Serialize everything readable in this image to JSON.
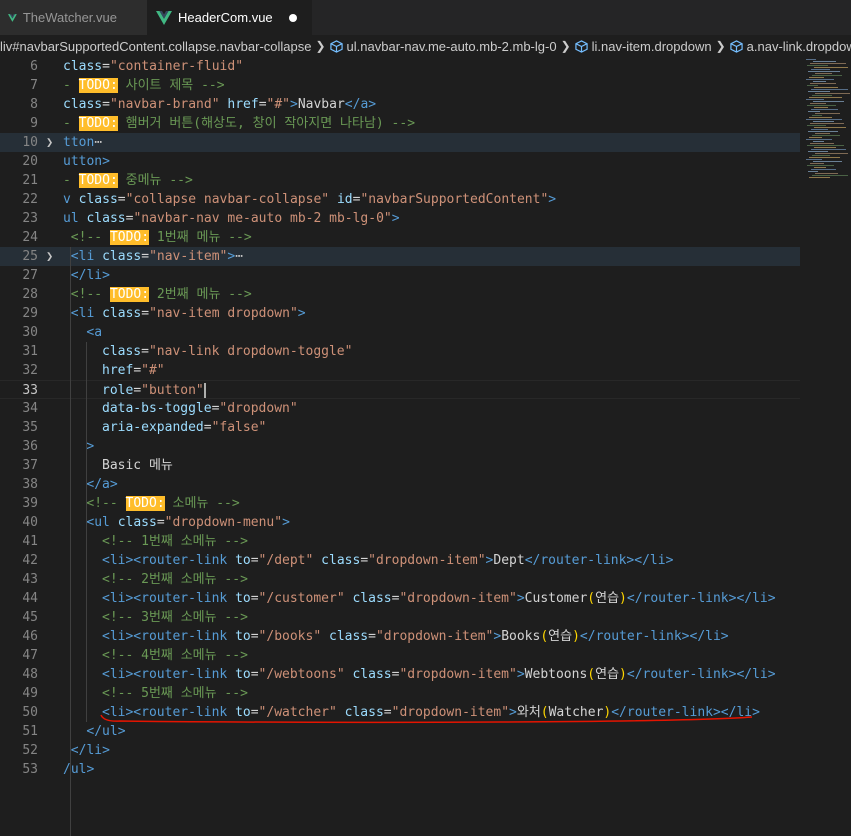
{
  "tabs": [
    {
      "label": "TheWatcher.vue",
      "active": false,
      "icon": "vue-icon"
    },
    {
      "label": "HeaderCom.vue",
      "active": true,
      "icon": "vue-icon",
      "dirty": true
    }
  ],
  "breadcrumb": [
    {
      "label": "liv#navbarSupportedContent.collapse.navbar-collapse"
    },
    {
      "label": "ul.navbar-nav.me-auto.mb-2.mb-lg-0"
    },
    {
      "label": "li.nav-item.dropdown"
    },
    {
      "label": "a.nav-link.dropdown"
    }
  ],
  "lines": [
    {
      "n": "6",
      "indent": 0,
      "tokens": [
        [
          "attr",
          "class"
        ],
        [
          "txt",
          "="
        ],
        [
          "str",
          "\"container-fluid\""
        ]
      ]
    },
    {
      "n": "7",
      "indent": 0,
      "tokens": [
        [
          "com",
          "- "
        ],
        [
          "todo",
          "TODO:"
        ],
        [
          "com",
          " 사이트 제목 -->"
        ]
      ]
    },
    {
      "n": "8",
      "indent": 0,
      "tokens": [
        [
          "attr",
          "class"
        ],
        [
          "txt",
          "="
        ],
        [
          "str",
          "\"navbar-brand\""
        ],
        [
          "txt",
          " "
        ],
        [
          "attr",
          "href"
        ],
        [
          "txt",
          "="
        ],
        [
          "str",
          "\"#\""
        ],
        [
          "tag",
          ">"
        ],
        [
          "txt",
          "Navbar"
        ],
        [
          "tag",
          "</a>"
        ]
      ]
    },
    {
      "n": "9",
      "indent": 0,
      "tokens": [
        [
          "com",
          "- "
        ],
        [
          "todo",
          "TODO:"
        ],
        [
          "com",
          " 햄버거 버튼(해상도, 창이 작아지면 나타남) -->"
        ]
      ]
    },
    {
      "n": "10",
      "indent": 0,
      "fold": true,
      "hl": true,
      "tokens": [
        [
          "tag",
          "tton"
        ],
        [
          "ellip",
          "⋯"
        ]
      ]
    },
    {
      "n": "20",
      "indent": 0,
      "tokens": [
        [
          "tag",
          "utton>"
        ]
      ]
    },
    {
      "n": "21",
      "indent": 0,
      "tokens": [
        [
          "com",
          "- "
        ],
        [
          "todo",
          "TODO:"
        ],
        [
          "com",
          " 중메뉴 -->"
        ]
      ]
    },
    {
      "n": "22",
      "indent": 0,
      "tokens": [
        [
          "tag",
          "v "
        ],
        [
          "attr",
          "class"
        ],
        [
          "txt",
          "="
        ],
        [
          "str",
          "\"collapse navbar-collapse\""
        ],
        [
          "txt",
          " "
        ],
        [
          "attr",
          "id"
        ],
        [
          "txt",
          "="
        ],
        [
          "str",
          "\"navbarSupportedContent\""
        ],
        [
          "tag",
          ">"
        ]
      ]
    },
    {
      "n": "23",
      "indent": 0,
      "tokens": [
        [
          "tag",
          "ul "
        ],
        [
          "attr",
          "class"
        ],
        [
          "txt",
          "="
        ],
        [
          "str",
          "\"navbar-nav me-auto mb-2 mb-lg-0\""
        ],
        [
          "tag",
          ">"
        ]
      ]
    },
    {
      "n": "24",
      "indent": 1,
      "tokens": [
        [
          "com",
          "<!-- "
        ],
        [
          "todo",
          "TODO:"
        ],
        [
          "com",
          " 1번째 메뉴 -->"
        ]
      ]
    },
    {
      "n": "25",
      "indent": 1,
      "fold": true,
      "hl": true,
      "tokens": [
        [
          "tag",
          "<li "
        ],
        [
          "attr",
          "class"
        ],
        [
          "txt",
          "="
        ],
        [
          "str",
          "\"nav-item\""
        ],
        [
          "tag",
          ">"
        ],
        [
          "ellip",
          "⋯"
        ]
      ]
    },
    {
      "n": "27",
      "indent": 1,
      "tokens": [
        [
          "tag",
          "</li>"
        ]
      ]
    },
    {
      "n": "28",
      "indent": 1,
      "tokens": [
        [
          "com",
          "<!-- "
        ],
        [
          "todo",
          "TODO:"
        ],
        [
          "com",
          " 2번째 메뉴 -->"
        ]
      ]
    },
    {
      "n": "29",
      "indent": 1,
      "tokens": [
        [
          "tag",
          "<li "
        ],
        [
          "attr",
          "class"
        ],
        [
          "txt",
          "="
        ],
        [
          "str",
          "\"nav-item dropdown\""
        ],
        [
          "tag",
          ">"
        ]
      ]
    },
    {
      "n": "30",
      "indent": 3,
      "tokens": [
        [
          "tag",
          "<a"
        ]
      ]
    },
    {
      "n": "31",
      "indent": 5,
      "tokens": [
        [
          "attr",
          "class"
        ],
        [
          "txt",
          "="
        ],
        [
          "str",
          "\"nav-link dropdown-toggle\""
        ]
      ]
    },
    {
      "n": "32",
      "indent": 5,
      "tokens": [
        [
          "attr",
          "href"
        ],
        [
          "txt",
          "="
        ],
        [
          "str",
          "\"#\""
        ]
      ]
    },
    {
      "n": "33",
      "indent": 5,
      "cursor": true,
      "tokens": [
        [
          "attr",
          "role"
        ],
        [
          "txt",
          "="
        ],
        [
          "str",
          "\"button\""
        ]
      ]
    },
    {
      "n": "34",
      "indent": 5,
      "tokens": [
        [
          "attr",
          "data-bs-toggle"
        ],
        [
          "txt",
          "="
        ],
        [
          "str",
          "\"dropdown\""
        ]
      ]
    },
    {
      "n": "35",
      "indent": 5,
      "tokens": [
        [
          "attr",
          "aria-expanded"
        ],
        [
          "txt",
          "="
        ],
        [
          "str",
          "\"false\""
        ]
      ]
    },
    {
      "n": "36",
      "indent": 3,
      "tokens": [
        [
          "tag",
          ">"
        ]
      ]
    },
    {
      "n": "37",
      "indent": 5,
      "tokens": [
        [
          "txt",
          "Basic 메뉴"
        ]
      ]
    },
    {
      "n": "38",
      "indent": 3,
      "tokens": [
        [
          "tag",
          "</a>"
        ]
      ]
    },
    {
      "n": "39",
      "indent": 3,
      "tokens": [
        [
          "com",
          "<!-- "
        ],
        [
          "todo",
          "TODO:"
        ],
        [
          "com",
          " 소메뉴 -->"
        ]
      ]
    },
    {
      "n": "40",
      "indent": 3,
      "tokens": [
        [
          "tag",
          "<ul "
        ],
        [
          "attr",
          "class"
        ],
        [
          "txt",
          "="
        ],
        [
          "str",
          "\"dropdown-menu\""
        ],
        [
          "tag",
          ">"
        ]
      ]
    },
    {
      "n": "41",
      "indent": 5,
      "tokens": [
        [
          "com",
          "<!-- 1번째 소메뉴 -->"
        ]
      ]
    },
    {
      "n": "42",
      "indent": 5,
      "tokens": [
        [
          "tag",
          "<li><router-link "
        ],
        [
          "attr",
          "to"
        ],
        [
          "txt",
          "="
        ],
        [
          "str",
          "\"/dept\""
        ],
        [
          "txt",
          " "
        ],
        [
          "attr",
          "class"
        ],
        [
          "txt",
          "="
        ],
        [
          "str",
          "\"dropdown-item\""
        ],
        [
          "tag",
          ">"
        ],
        [
          "txt",
          "Dept"
        ],
        [
          "tag",
          "</router-link></li>"
        ]
      ]
    },
    {
      "n": "43",
      "indent": 5,
      "tokens": [
        [
          "com",
          "<!-- 2번째 소메뉴 -->"
        ]
      ]
    },
    {
      "n": "44",
      "indent": 5,
      "tokens": [
        [
          "tag",
          "<li><router-link "
        ],
        [
          "attr",
          "to"
        ],
        [
          "txt",
          "="
        ],
        [
          "str",
          "\"/customer\""
        ],
        [
          "txt",
          " "
        ],
        [
          "attr",
          "class"
        ],
        [
          "txt",
          "="
        ],
        [
          "str",
          "\"dropdown-item\""
        ],
        [
          "tag",
          ">"
        ],
        [
          "txt",
          "Customer"
        ],
        [
          "paren",
          "("
        ],
        [
          "txt",
          "연습"
        ],
        [
          "paren",
          ")"
        ],
        [
          "tag",
          "</router-link></li>"
        ]
      ]
    },
    {
      "n": "45",
      "indent": 5,
      "tokens": [
        [
          "com",
          "<!-- 3번째 소메뉴 -->"
        ]
      ]
    },
    {
      "n": "46",
      "indent": 5,
      "tokens": [
        [
          "tag",
          "<li><router-link "
        ],
        [
          "attr",
          "to"
        ],
        [
          "txt",
          "="
        ],
        [
          "str",
          "\"/books\""
        ],
        [
          "txt",
          " "
        ],
        [
          "attr",
          "class"
        ],
        [
          "txt",
          "="
        ],
        [
          "str",
          "\"dropdown-item\""
        ],
        [
          "tag",
          ">"
        ],
        [
          "txt",
          "Books"
        ],
        [
          "paren",
          "("
        ],
        [
          "txt",
          "연습"
        ],
        [
          "paren",
          ")"
        ],
        [
          "tag",
          "</router-link></li>"
        ]
      ]
    },
    {
      "n": "47",
      "indent": 5,
      "tokens": [
        [
          "com",
          "<!-- 4번째 소메뉴 -->"
        ]
      ]
    },
    {
      "n": "48",
      "indent": 5,
      "tokens": [
        [
          "tag",
          "<li><router-link "
        ],
        [
          "attr",
          "to"
        ],
        [
          "txt",
          "="
        ],
        [
          "str",
          "\"/webtoons\""
        ],
        [
          "txt",
          " "
        ],
        [
          "attr",
          "class"
        ],
        [
          "txt",
          "="
        ],
        [
          "str",
          "\"dropdown-item\""
        ],
        [
          "tag",
          ">"
        ],
        [
          "txt",
          "Webtoons"
        ],
        [
          "paren",
          "("
        ],
        [
          "txt",
          "연습"
        ],
        [
          "paren",
          ")"
        ],
        [
          "tag",
          "</router-link></li>"
        ]
      ]
    },
    {
      "n": "49",
      "indent": 5,
      "tokens": [
        [
          "com",
          "<!-- 5번째 소메뉴 -->"
        ]
      ]
    },
    {
      "n": "50",
      "indent": 5,
      "tokens": [
        [
          "tag",
          "<li><router-link "
        ],
        [
          "attr",
          "to"
        ],
        [
          "txt",
          "="
        ],
        [
          "str",
          "\"/watcher\""
        ],
        [
          "txt",
          " "
        ],
        [
          "attr",
          "class"
        ],
        [
          "txt",
          "="
        ],
        [
          "str",
          "\"dropdown-item\""
        ],
        [
          "tag",
          ">"
        ],
        [
          "txt",
          "와처"
        ],
        [
          "paren",
          "("
        ],
        [
          "txt",
          "Watcher"
        ],
        [
          "paren",
          ")"
        ],
        [
          "tag",
          "</router-link></li>"
        ]
      ]
    },
    {
      "n": "51",
      "indent": 3,
      "tokens": [
        [
          "tag",
          "</ul>"
        ]
      ]
    },
    {
      "n": "52",
      "indent": 1,
      "tokens": [
        [
          "tag",
          "</li>"
        ]
      ]
    },
    {
      "n": "53",
      "indent": 0,
      "tokens": [
        [
          "tag",
          "/ul>"
        ]
      ]
    }
  ],
  "colors": {
    "accent": "#007acc",
    "annotation": "#e51400",
    "todo": "#ffbd2a",
    "vue": "#41b883"
  }
}
